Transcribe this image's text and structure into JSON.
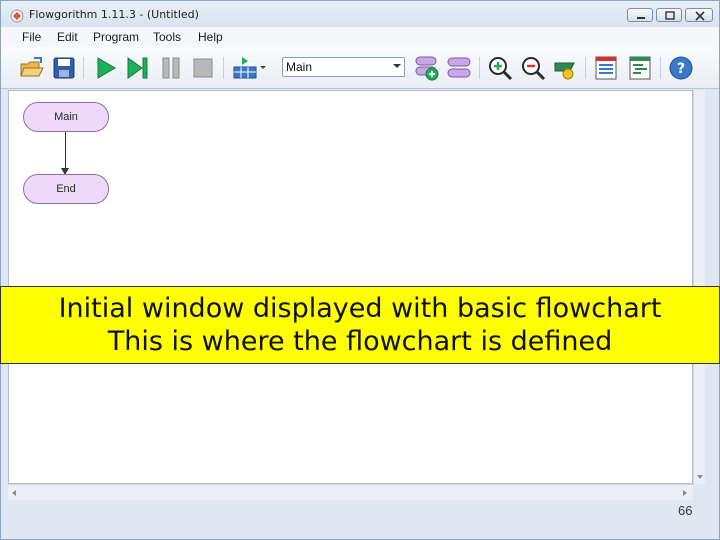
{
  "window": {
    "title": "Flowgorithm 1.11.3 - (Untitled)"
  },
  "menu": {
    "items": [
      "File",
      "Edit",
      "Program",
      "Tools",
      "Help"
    ]
  },
  "toolbar": {
    "function_select_value": "Main",
    "icons": [
      "open-folder-icon",
      "save-icon",
      "run-icon",
      "step-icon",
      "pause-icon",
      "stop-icon",
      "layout-icon",
      "add-function-icon",
      "remove-function-icon",
      "zoom-in-icon",
      "zoom-out-icon",
      "style-icon",
      "variable-watch-icon",
      "console-icon",
      "help-icon"
    ]
  },
  "flowchart": {
    "start_label": "Main",
    "end_label": "End"
  },
  "caption": {
    "line1": "Initial window displayed with basic flowchart",
    "line2": "This is where the flowchart is defined"
  },
  "slide_number": "66",
  "colors": {
    "caption_bg": "#ffff00",
    "terminal_fill": "#efd9f8",
    "terminal_border": "#8f6ea8"
  }
}
